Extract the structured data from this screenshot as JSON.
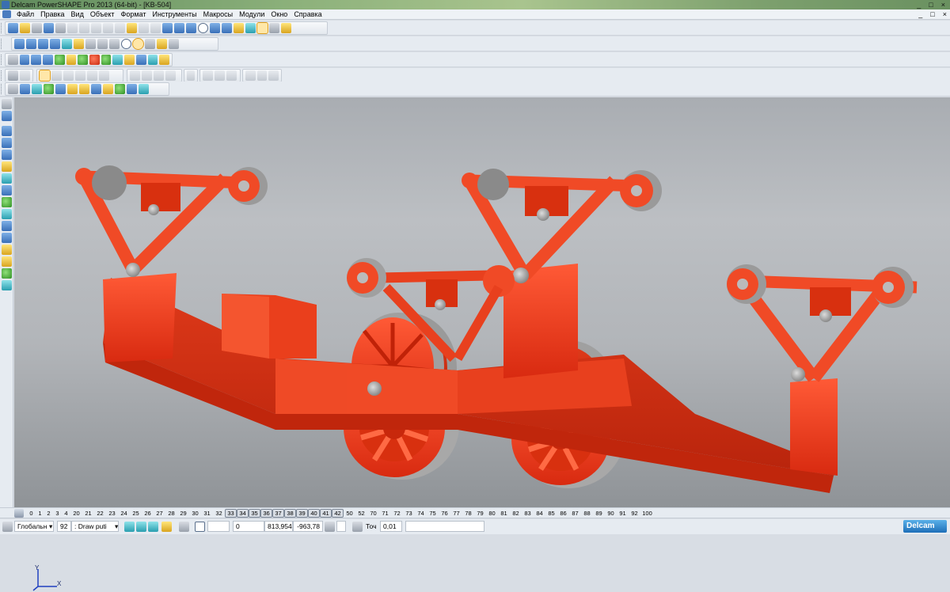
{
  "window": {
    "title": "Delcam PowerSHAPE Pro 2013 (64-bit) - [KB-504]",
    "controls": [
      "_",
      "□",
      "×"
    ]
  },
  "menu": {
    "items": [
      "Файл",
      "Правка",
      "Вид",
      "Объект",
      "Формат",
      "Инструменты",
      "Макросы",
      "Модули",
      "Окно",
      "Справка"
    ],
    "right_controls": [
      "_",
      "□",
      "×"
    ]
  },
  "viewport": {
    "axis_x": "X",
    "axis_y": "Y",
    "model_color": "#f03c1e",
    "hardware_color": "#9a9a9a"
  },
  "levels": {
    "numbers": [
      "0",
      "1",
      "2",
      "3",
      "4",
      "20",
      "21",
      "22",
      "23",
      "24",
      "25",
      "26",
      "27",
      "28",
      "29",
      "30",
      "31",
      "32",
      "33",
      "34",
      "35",
      "36",
      "37",
      "38",
      "39",
      "40",
      "41",
      "42",
      "50",
      "52",
      "70",
      "71",
      "72",
      "73",
      "74",
      "75",
      "76",
      "77",
      "78",
      "79",
      "80",
      "81",
      "82",
      "83",
      "84",
      "85",
      "86",
      "87",
      "88",
      "89",
      "90",
      "91",
      "92",
      "100"
    ],
    "active": [
      "33",
      "34",
      "35",
      "36",
      "37",
      "38",
      "39",
      "40",
      "41",
      "42"
    ]
  },
  "status": {
    "workplane": "Глобальн",
    "level_number": "92",
    "level_name": ": Draw puti",
    "value_a": "0",
    "coord_x": "813,954",
    "coord_y": "-963,78",
    "tolerance_label": "Точ",
    "tolerance": "0,01",
    "brand": "Delcam"
  }
}
